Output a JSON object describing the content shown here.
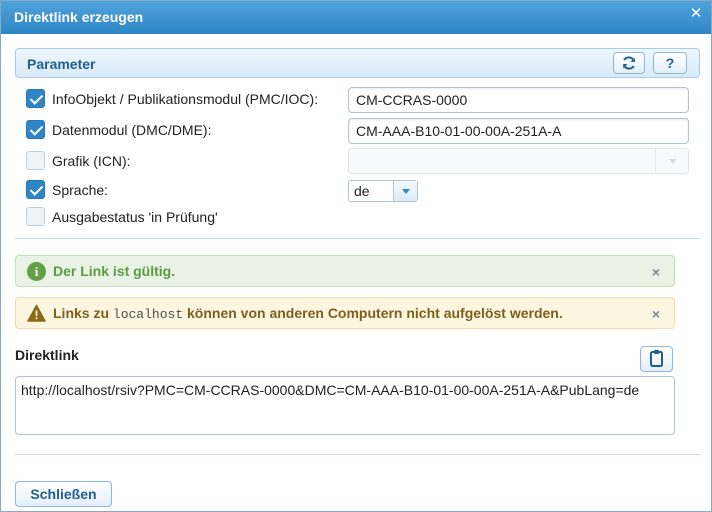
{
  "window": {
    "title": "Direktlink erzeugen",
    "close_glyph": "✕"
  },
  "parameter": {
    "header": "Parameter",
    "refresh_icon": "refresh-icon",
    "help_label": "?",
    "items": [
      {
        "label": "InfoObjekt / Publikationsmodul (PMC/IOC):",
        "checked": true,
        "value": "CM-CCRAS-0000"
      },
      {
        "label": "Datenmodul (DMC/DME):",
        "checked": true,
        "value": "CM-AAA-B10-01-00-00A-251A-A"
      },
      {
        "label": "Grafik (ICN):",
        "checked": false,
        "value": ""
      },
      {
        "label": "Sprache:",
        "checked": true,
        "value": "de"
      },
      {
        "label": "Ausgabestatus 'in Prüfung'",
        "checked": false
      }
    ]
  },
  "alerts": {
    "success_text": "Der Link ist gültig.",
    "warning_prefix": "Links zu",
    "warning_code": "localhost",
    "warning_suffix": "können von anderen Computern nicht aufgelöst werden.",
    "close_glyph": "×"
  },
  "direktlink": {
    "label": "Direktlink",
    "url": "http://localhost/rsiv?PMC=CM-CCRAS-0000&DMC=CM-AAA-B10-01-00-00A-251A-A&PubLang=de"
  },
  "footer": {
    "close_label": "Schließen"
  },
  "colors": {
    "title_bar": "#2f86c6",
    "success": "#63a047",
    "warning": "#c9a227"
  }
}
